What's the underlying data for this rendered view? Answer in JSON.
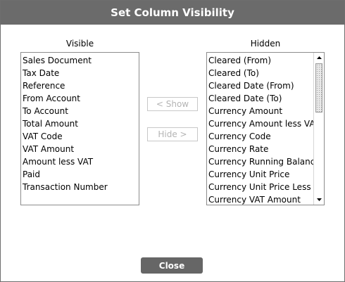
{
  "dialog": {
    "title": "Set Column Visibility",
    "close_label": "Close"
  },
  "visible": {
    "label": "Visible",
    "items": [
      "Sales Document",
      "Tax Date",
      "Reference",
      "From Account",
      "To Account",
      "Total Amount",
      "VAT Code",
      "VAT Amount",
      "Amount less VAT",
      "Paid",
      "Transaction Number"
    ]
  },
  "hidden": {
    "label": "Hidden",
    "items": [
      "Cleared (From)",
      "Cleared (To)",
      "Cleared Date (From)",
      "Cleared Date (To)",
      "Currency Amount",
      "Currency Amount less VAT",
      "Currency Code",
      "Currency Rate",
      "Currency Running Balance",
      "Currency Unit Price",
      "Currency Unit Price Less VAT",
      "Currency VAT Amount"
    ]
  },
  "actions": {
    "show_label": "< Show",
    "hide_label": "Hide >"
  },
  "colors": {
    "titlebar": "#6b6b6b",
    "close_button": "#666666",
    "disabled_text": "#b4b4b4"
  }
}
